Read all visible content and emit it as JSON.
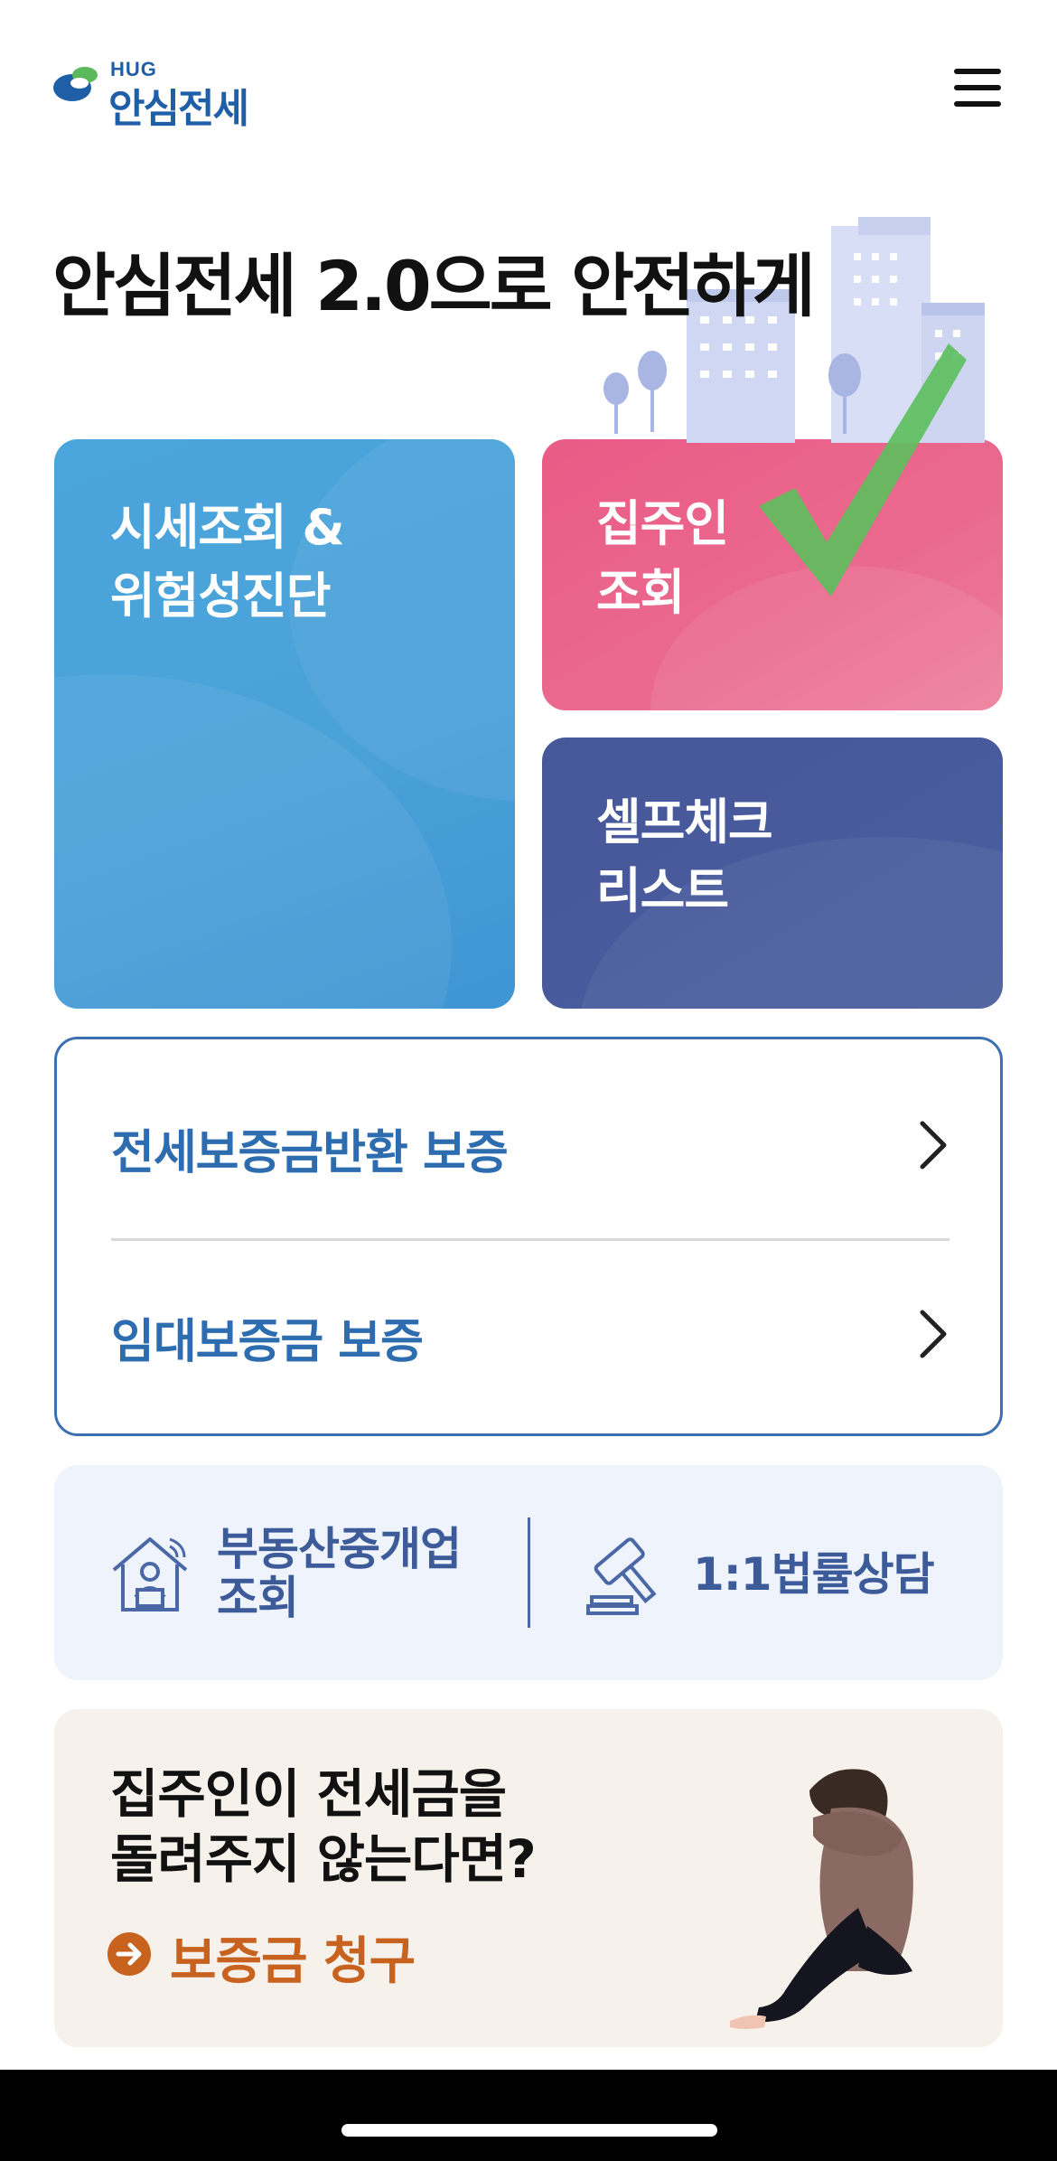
{
  "header": {
    "logo_small": "HUG",
    "logo_text": "안심전세",
    "menu_icon": "hamburger-menu-icon"
  },
  "hero": {
    "title": "안심전세 2.0으로 안전하게"
  },
  "tiles": {
    "market": {
      "label": "시세조회 &\n위험성진단",
      "color": "#4aa5dc"
    },
    "owner": {
      "label": "집주인\n조회",
      "color": "#e95b86"
    },
    "check": {
      "label": "셀프체크\n리스트",
      "color": "#46579a"
    }
  },
  "guarantee": {
    "items": [
      {
        "label": "전세보증금반환 보증",
        "icon": "chevron-right-icon"
      },
      {
        "label": "임대보증금 보증",
        "icon": "chevron-right-icon"
      }
    ]
  },
  "quick_links": {
    "broker": {
      "label": "부동산중개업\n조회",
      "icon": "house-agent-icon"
    },
    "legal": {
      "label": "1:1법률상담",
      "icon": "gavel-icon"
    }
  },
  "claim": {
    "title": "집주인이 전세금을\n돌려주지 않는다면?",
    "link": "보증금 청구",
    "link_icon": "arrow-circle-right-icon"
  },
  "colors": {
    "accent_blue": "#2e6cb0",
    "claim_orange": "#c8621f"
  }
}
